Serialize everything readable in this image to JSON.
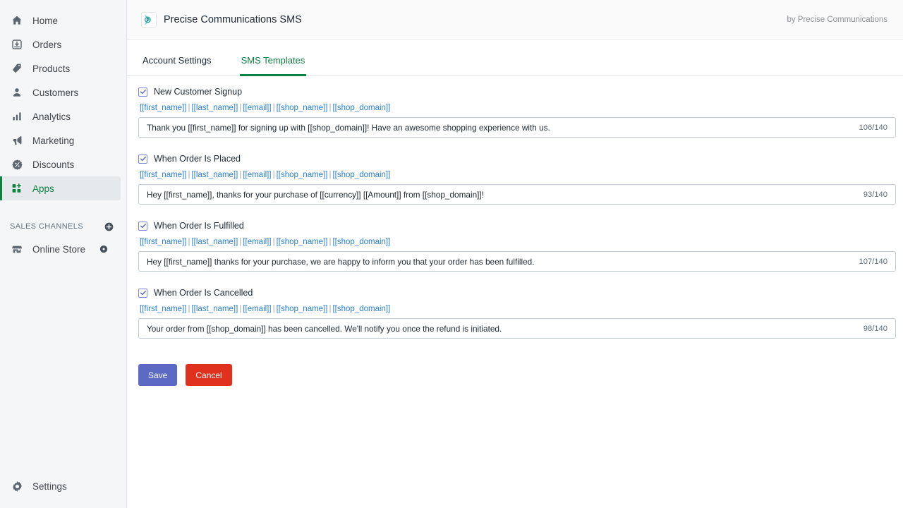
{
  "sidebar": {
    "items": [
      {
        "label": "Home",
        "icon": "home-icon",
        "active": false
      },
      {
        "label": "Orders",
        "icon": "orders-icon",
        "active": false
      },
      {
        "label": "Products",
        "icon": "products-tag-icon",
        "active": false
      },
      {
        "label": "Customers",
        "icon": "customers-person-icon",
        "active": false
      },
      {
        "label": "Analytics",
        "icon": "analytics-bars-icon",
        "active": false
      },
      {
        "label": "Marketing",
        "icon": "marketing-megaphone-icon",
        "active": false
      },
      {
        "label": "Discounts",
        "icon": "discounts-percent-icon",
        "active": false
      },
      {
        "label": "Apps",
        "icon": "apps-grid-icon",
        "active": true
      }
    ],
    "sales_channels_label": "SALES CHANNELS",
    "add_channel_icon": "plus-circle-icon",
    "online_store": {
      "label": "Online Store",
      "icon": "store-icon",
      "trailing_icon": "view-eye-icon"
    },
    "settings": {
      "label": "Settings",
      "icon": "gear-icon"
    }
  },
  "header": {
    "logo_icon": "precise-communications-logo-icon",
    "title": "Precise Communications SMS",
    "byline": "by Precise Communications"
  },
  "tabs": [
    {
      "label": "Account Settings",
      "active": false
    },
    {
      "label": "SMS Templates",
      "active": true
    }
  ],
  "variables": {
    "items": [
      "[[first_name]]",
      "[[last_name]]",
      "[[email]]",
      "[[shop_name]]",
      "[[shop_domain]]"
    ],
    "separator": "|"
  },
  "templates": [
    {
      "label": "New Customer Signup",
      "checked": true,
      "message": "Thank you [[first_name]] for signing up with [[shop_domain]]! Have an awesome shopping experience with us.",
      "counter": "106/140"
    },
    {
      "label": "When Order Is Placed",
      "checked": true,
      "message": "Hey [[first_name]], thanks for your purchase of [[currency]] [[Amount]] from [[shop_domain]]!",
      "counter": "93/140"
    },
    {
      "label": "When Order Is Fulfilled",
      "checked": true,
      "message": "Hey [[first_name]] thanks for your purchase, we are happy to inform you that your order has been fulfilled.",
      "counter": "107/140"
    },
    {
      "label": "When Order Is Cancelled",
      "checked": true,
      "message": "Your order from [[shop_domain]] has been cancelled. We'll notify you once the refund is initiated.",
      "counter": "98/140"
    }
  ],
  "actions": {
    "save_label": "Save",
    "cancel_label": "Cancel"
  },
  "colors": {
    "accent_green": "#108043",
    "link_blue": "#2a7fd4",
    "save_purple": "#5c6ac4",
    "cancel_red": "#e0301e",
    "sidebar_bg": "#f4f6f8",
    "checkbox_border": "#7b8ad6"
  }
}
